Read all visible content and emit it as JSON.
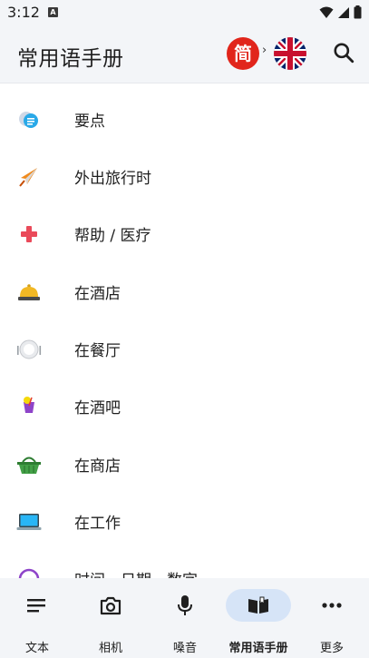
{
  "status": {
    "time": "3:12",
    "badge": "A"
  },
  "app_bar": {
    "title": "常用语手册",
    "source_lang_glyph": "简",
    "arrow": "›",
    "target_lang_icon": "uk-flag-icon"
  },
  "list": {
    "items": [
      {
        "label": "要点",
        "icon": "chat-bubble-icon"
      },
      {
        "label": "外出旅行时",
        "icon": "airplane-icon"
      },
      {
        "label": "帮助 / 医疗",
        "icon": "medical-cross-icon"
      },
      {
        "label": "在酒店",
        "icon": "hotel-bell-icon"
      },
      {
        "label": "在餐厅",
        "icon": "plate-icon"
      },
      {
        "label": "在酒吧",
        "icon": "cocktail-icon"
      },
      {
        "label": "在商店",
        "icon": "basket-icon"
      },
      {
        "label": "在工作",
        "icon": "laptop-icon"
      },
      {
        "label": "时间、日期、数字",
        "icon": "clock-icon"
      }
    ]
  },
  "bottom_nav": {
    "items": [
      {
        "label": "文本",
        "icon": "text-lines-icon",
        "active": false
      },
      {
        "label": "相机",
        "icon": "camera-icon",
        "active": false
      },
      {
        "label": "嗓音",
        "icon": "microphone-icon",
        "active": false
      },
      {
        "label": "常用语手册",
        "icon": "open-book-icon",
        "active": true
      },
      {
        "label": "更多",
        "icon": "more-dots-icon",
        "active": false
      }
    ]
  },
  "colors": {
    "accent": "#d6e4f7",
    "chinese_badge": "#e1251b",
    "bar_bg": "#f3f5f8"
  }
}
